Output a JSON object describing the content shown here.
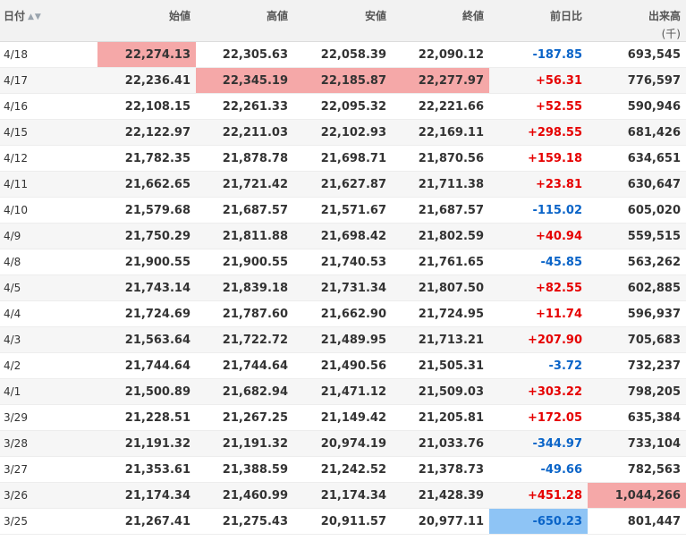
{
  "header": {
    "date": "日付",
    "open": "始値",
    "high": "高値",
    "low": "安値",
    "close": "終値",
    "change": "前日比",
    "volume": "出来高",
    "volume_unit": "(千)",
    "sort_glyph": "▲▼"
  },
  "colors": {
    "positive": "#e60000",
    "negative": "#0a64c8",
    "highlight_max": "#f5a8a8",
    "highlight_min": "#8ec4f5",
    "header_bg": "#f2f2f2",
    "stripe_bg": "#f6f6f6"
  },
  "rows": [
    {
      "date": "4/18",
      "open": "22,274.13",
      "high": "22,305.63",
      "low": "22,058.39",
      "close": "22,090.12",
      "change": "-187.85",
      "volume": "693,545",
      "hl": [
        "open"
      ]
    },
    {
      "date": "4/17",
      "open": "22,236.41",
      "high": "22,345.19",
      "low": "22,185.87",
      "close": "22,277.97",
      "change": "+56.31",
      "volume": "776,597",
      "hl": [
        "high",
        "low",
        "close"
      ]
    },
    {
      "date": "4/16",
      "open": "22,108.15",
      "high": "22,261.33",
      "low": "22,095.32",
      "close": "22,221.66",
      "change": "+52.55",
      "volume": "590,946",
      "hl": []
    },
    {
      "date": "4/15",
      "open": "22,122.97",
      "high": "22,211.03",
      "low": "22,102.93",
      "close": "22,169.11",
      "change": "+298.55",
      "volume": "681,426",
      "hl": []
    },
    {
      "date": "4/12",
      "open": "21,782.35",
      "high": "21,878.78",
      "low": "21,698.71",
      "close": "21,870.56",
      "change": "+159.18",
      "volume": "634,651",
      "hl": []
    },
    {
      "date": "4/11",
      "open": "21,662.65",
      "high": "21,721.42",
      "low": "21,627.87",
      "close": "21,711.38",
      "change": "+23.81",
      "volume": "630,647",
      "hl": []
    },
    {
      "date": "4/10",
      "open": "21,579.68",
      "high": "21,687.57",
      "low": "21,571.67",
      "close": "21,687.57",
      "change": "-115.02",
      "volume": "605,020",
      "hl": []
    },
    {
      "date": "4/9",
      "open": "21,750.29",
      "high": "21,811.88",
      "low": "21,698.42",
      "close": "21,802.59",
      "change": "+40.94",
      "volume": "559,515",
      "hl": []
    },
    {
      "date": "4/8",
      "open": "21,900.55",
      "high": "21,900.55",
      "low": "21,740.53",
      "close": "21,761.65",
      "change": "-45.85",
      "volume": "563,262",
      "hl": []
    },
    {
      "date": "4/5",
      "open": "21,743.14",
      "high": "21,839.18",
      "low": "21,731.34",
      "close": "21,807.50",
      "change": "+82.55",
      "volume": "602,885",
      "hl": []
    },
    {
      "date": "4/4",
      "open": "21,724.69",
      "high": "21,787.60",
      "low": "21,662.90",
      "close": "21,724.95",
      "change": "+11.74",
      "volume": "596,937",
      "hl": []
    },
    {
      "date": "4/3",
      "open": "21,563.64",
      "high": "21,722.72",
      "low": "21,489.95",
      "close": "21,713.21",
      "change": "+207.90",
      "volume": "705,683",
      "hl": []
    },
    {
      "date": "4/2",
      "open": "21,744.64",
      "high": "21,744.64",
      "low": "21,490.56",
      "close": "21,505.31",
      "change": "-3.72",
      "volume": "732,237",
      "hl": []
    },
    {
      "date": "4/1",
      "open": "21,500.89",
      "high": "21,682.94",
      "low": "21,471.12",
      "close": "21,509.03",
      "change": "+303.22",
      "volume": "798,205",
      "hl": []
    },
    {
      "date": "3/29",
      "open": "21,228.51",
      "high": "21,267.25",
      "low": "21,149.42",
      "close": "21,205.81",
      "change": "+172.05",
      "volume": "635,384",
      "hl": []
    },
    {
      "date": "3/28",
      "open": "21,191.32",
      "high": "21,191.32",
      "low": "20,974.19",
      "close": "21,033.76",
      "change": "-344.97",
      "volume": "733,104",
      "hl": []
    },
    {
      "date": "3/27",
      "open": "21,353.61",
      "high": "21,388.59",
      "low": "21,242.52",
      "close": "21,378.73",
      "change": "-49.66",
      "volume": "782,563",
      "hl": []
    },
    {
      "date": "3/26",
      "open": "21,174.34",
      "high": "21,460.99",
      "low": "21,174.34",
      "close": "21,428.39",
      "change": "+451.28",
      "volume": "1,044,266",
      "hl": [
        "volume"
      ]
    },
    {
      "date": "3/25",
      "open": "21,267.41",
      "high": "21,275.43",
      "low": "20,911.57",
      "close": "20,977.11",
      "change": "-650.23",
      "volume": "801,447",
      "hl": [
        "change-min"
      ]
    }
  ]
}
